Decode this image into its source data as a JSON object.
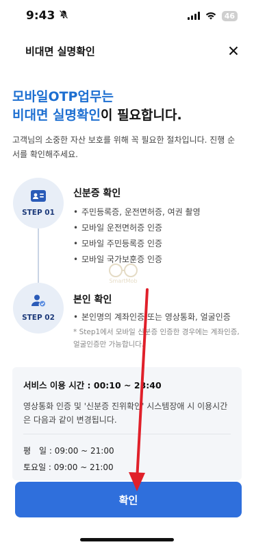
{
  "status_bar": {
    "time": "9:43",
    "battery": "46"
  },
  "header": {
    "title": "비대면 실명확인"
  },
  "headline": {
    "line1_blue": "모바일OTP업무는",
    "line2_blue": "비대면 실명확인",
    "line2_dark": "이 필요합니다."
  },
  "intro": "고객님의 소중한 자산 보호를 위해 꼭 필요한 절차입니다. 진행 순서를 확인해주세요.",
  "steps": [
    {
      "label": "STEP 01",
      "title": "신분증 확인",
      "icon": "id-card-icon",
      "bullets": [
        "주민등록증, 운전면허증, 여권 촬영",
        "모바일 운전면허증 인증",
        "모바일 주민등록증 인증",
        "모바일 국가보훈증 인증"
      ]
    },
    {
      "label": "STEP 02",
      "title": "본인 확인",
      "icon": "user-check-icon",
      "bullets": [
        "본인명의 계좌인증 또는 영상통화, 얼굴인증"
      ],
      "note": "* Step1에서 모바일 신분증 인증한 경우에는 계좌인증, 얼굴인증만 가능합니다."
    }
  ],
  "watermark": "SmartMob",
  "service": {
    "title": "서비스 이용 시간 : 00:10 ~ 23:40",
    "desc": "영상통화 인증 및 '신분증 진위확인' 시스템장애 시 이용시간은 다음과 같이 변경됩니다.",
    "rows": [
      "평　일 : 09:00 ~ 21:00",
      "토요일 : 09:00 ~ 21:00"
    ]
  },
  "confirm_label": "확인",
  "colors": {
    "accent": "#2f6fdc",
    "headline_blue": "#1d6fd1",
    "annotation_arrow": "#e0202a"
  }
}
